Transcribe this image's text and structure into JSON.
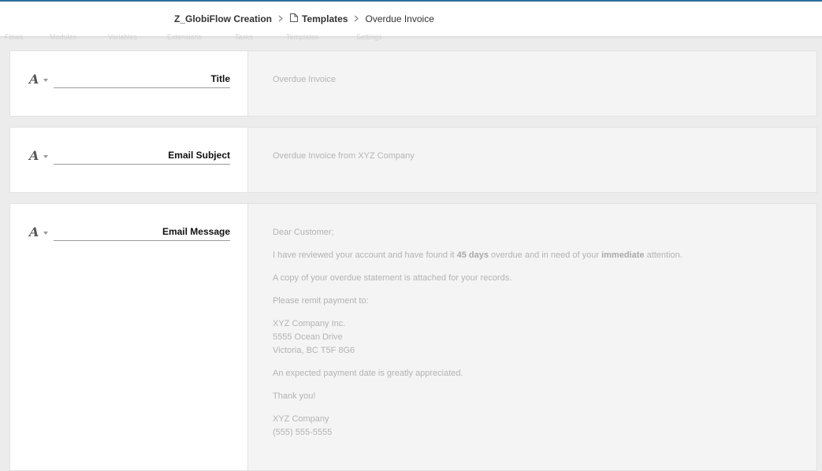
{
  "breadcrumb": {
    "workspace": "Z_GlobiFlow Creation",
    "section": "Templates",
    "current": "Overdue Invoice"
  },
  "ghost_nav": [
    "Flows",
    "Modules",
    "Variables",
    "Extensions",
    "Tasks",
    "Templates",
    "Settings"
  ],
  "icons": {
    "breadcrumb_separator": "chevron-right-icon",
    "section_icon": "document-icon",
    "field_type": "text-format-icon"
  },
  "colors": {
    "accent": "#2d6e9a"
  },
  "fields": {
    "title": {
      "type_glyph": "A",
      "label": "Title",
      "value": "Overdue Invoice"
    },
    "subject": {
      "type_glyph": "A",
      "label": "Email Subject",
      "value": "Overdue Invoice from XYZ Company"
    },
    "message": {
      "type_glyph": "A",
      "label": "Email Message",
      "greeting": "Dear Customer;",
      "line2_pre": "I have reviewed your account and have found it ",
      "line2_days": "45 days",
      "line2_mid": " overdue and in need of your ",
      "line2_emph": "immediate",
      "line2_post": " attention.",
      "line3": "A copy of your overdue statement is attached for your records.",
      "line4": "Please remit payment to:",
      "address1": "XYZ Company Inc.",
      "address2": "5555 Ocean Drive",
      "address3": "Victoria, BC T5F 8G6",
      "line5": "An expected payment date is greatly appreciated.",
      "line6": "Thank you!",
      "sig1": "XYZ Company",
      "sig2": "(555) 555-5555"
    }
  }
}
